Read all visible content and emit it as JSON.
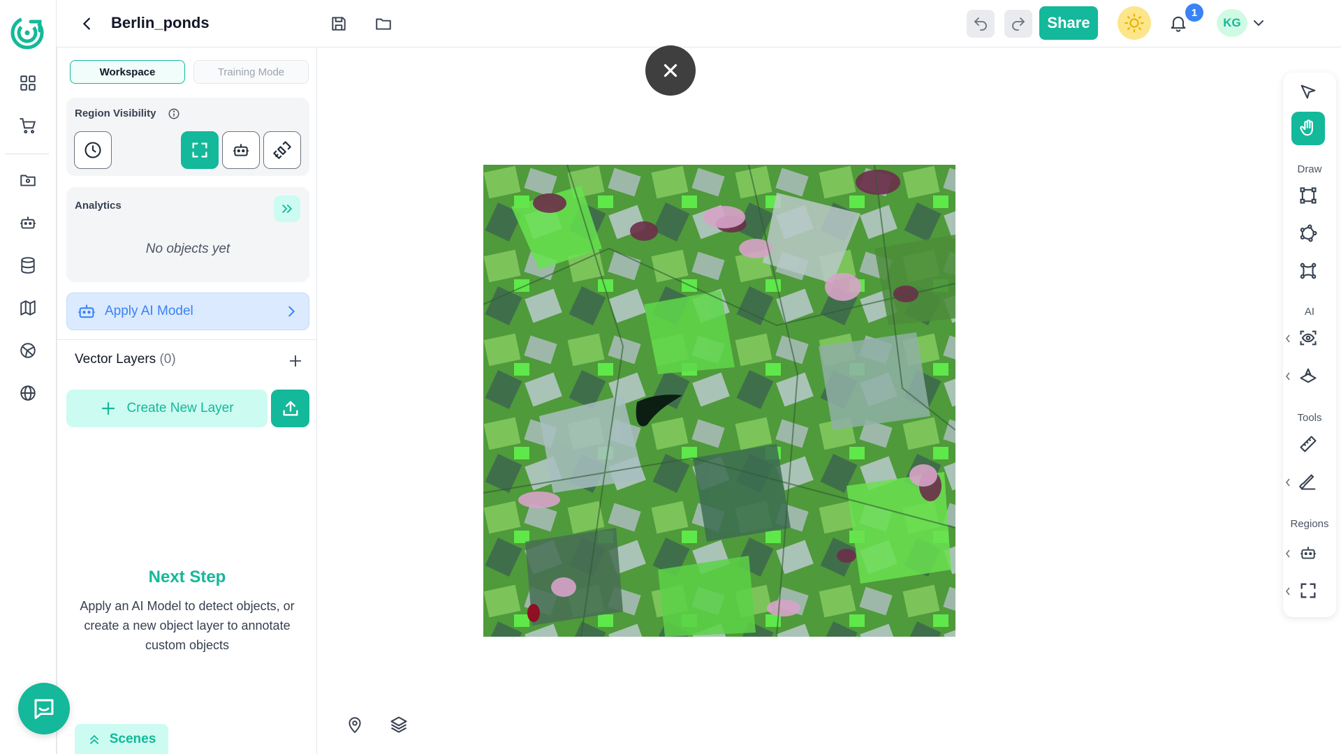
{
  "app": {
    "project_title": "Berlin_ponds"
  },
  "rail": {
    "items": [
      {
        "icon": "dashboard-grid-icon"
      },
      {
        "icon": "cart-icon"
      },
      {
        "icon": "folder-icon"
      },
      {
        "icon": "robot-icon"
      },
      {
        "icon": "database-icon"
      },
      {
        "icon": "map-icon"
      },
      {
        "icon": "globe-grid-icon"
      },
      {
        "icon": "globe-icon"
      }
    ]
  },
  "topbar": {
    "share_label": "Share",
    "notification_count": "1",
    "avatar_initials": "KG"
  },
  "panel": {
    "modes": [
      "Workspace",
      "Training Mode"
    ],
    "active_mode": "Workspace",
    "region_visibility_title": "Region Visibility",
    "analytics_title": "Analytics",
    "no_objects_text": "No objects yet",
    "apply_ai_label": "Apply AI Model",
    "vector_layers_title": "Vector Layers",
    "vector_layers_count": "(0)",
    "create_layer_label": "Create New Layer",
    "next_step_title": "Next Step",
    "next_step_text": "Apply an AI Model to detect objects, or create a new object layer to annotate custom objects",
    "scenes_label": "Scenes"
  },
  "right_toolbar": {
    "draw_label": "Draw",
    "ai_label": "AI",
    "tools_label": "Tools",
    "regions_label": "Regions"
  },
  "colors": {
    "accent": "#14b89a",
    "accent_light": "#ccfbf1",
    "ai_blue": "#3b82f6",
    "ai_blue_bg": "#dbeafe",
    "dark_fab": "#3f3f3f"
  }
}
